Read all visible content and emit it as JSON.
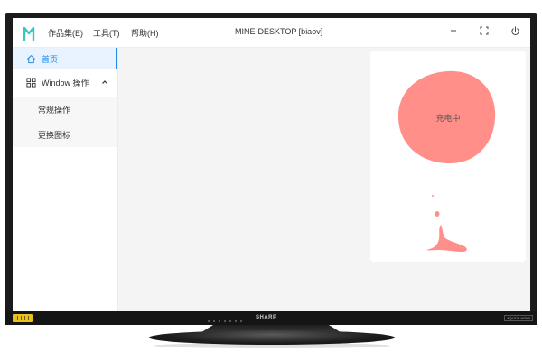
{
  "titlebar": {
    "menu_works": "作品集(E)",
    "menu_tools": "工具(T)",
    "menu_help": "帮助(H)",
    "window_title": "MINE-DESKTOP [biaov]"
  },
  "sidebar": {
    "items": [
      {
        "label": "首页",
        "icon": "home-icon",
        "active": true
      },
      {
        "label": "Window 操作",
        "icon": "windows-icon",
        "expanded": true
      },
      {
        "label": "常规操作"
      },
      {
        "label": "更换图标"
      }
    ]
  },
  "card": {
    "charge_label": "充电中"
  },
  "tv": {
    "brand": "SHARP",
    "badge": "AQUOS HDMI"
  },
  "colors": {
    "accent": "#1e8ae6",
    "charge_blob": "#ff8f88",
    "logo": "#39c6c0"
  }
}
